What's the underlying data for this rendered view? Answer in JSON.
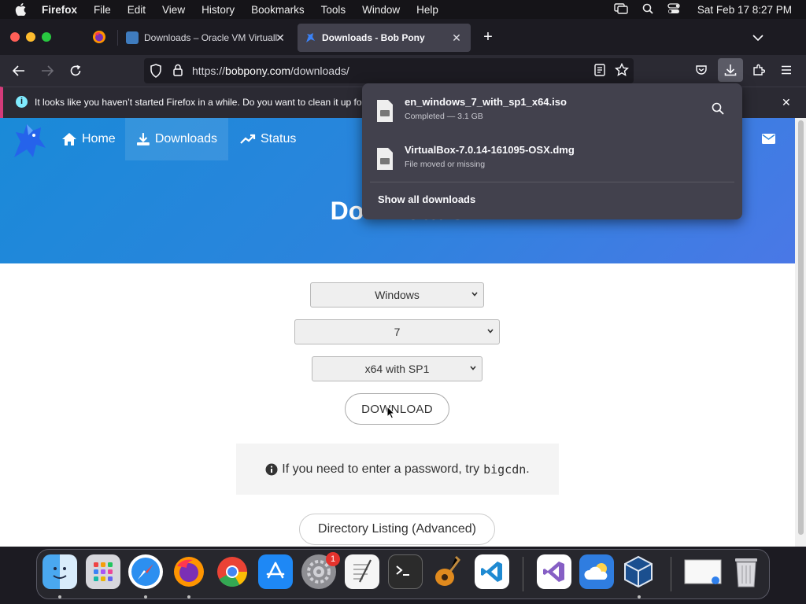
{
  "menubar": {
    "app": "Firefox",
    "items": [
      "File",
      "Edit",
      "View",
      "History",
      "Bookmarks",
      "Tools",
      "Window",
      "Help"
    ],
    "clock": "Sat Feb 17  8:27 PM"
  },
  "tabs": [
    {
      "title": "Downloads – Oracle VM Virtuall",
      "active": false
    },
    {
      "title": "Downloads - Bob Pony",
      "active": true
    }
  ],
  "navbar": {
    "url_prefix": "https://",
    "url_host": "bobpony.com",
    "url_path": "/downloads/"
  },
  "notification": {
    "text": "It looks like you haven’t started Firefox in a while. Do you want to clean it up for"
  },
  "site": {
    "nav": [
      {
        "label": "Home",
        "icon": "home-icon"
      },
      {
        "label": "Downloads",
        "icon": "download-icon",
        "active": true
      },
      {
        "label": "Status",
        "icon": "trend-icon"
      }
    ],
    "heading": "Downloads",
    "selects": [
      "Windows",
      "7",
      "x64 with SP1"
    ],
    "download_button": "DOWNLOAD",
    "password_text": "If you need to enter a password, try",
    "password_code": "bigcdn",
    "password_end": ".",
    "directory_button": "Directory Listing (Advanced)"
  },
  "downloads_panel": {
    "items": [
      {
        "name": "en_windows_7_with_sp1_x64.iso",
        "status": "Completed — 3.1 GB"
      },
      {
        "name": "VirtualBox-7.0.14-161095-OSX.dmg",
        "status": "File moved or missing"
      }
    ],
    "show_all": "Show all downloads"
  },
  "dock": {
    "apps": [
      "Finder",
      "Launchpad",
      "Safari",
      "Firefox",
      "Chrome",
      "App Store",
      "System Settings",
      "TextEdit",
      "Terminal",
      "GarageBand",
      "VS Code",
      "Visual Studio",
      "iCloud",
      "VirtualBox",
      "Desktop",
      "Trash"
    ],
    "settings_badge": "1"
  },
  "colors": {
    "accent_pink": "#d43b7a",
    "hero_blue": "#2b84dd",
    "firefox_dark": "#1c1b22",
    "panel": "#42414d"
  }
}
